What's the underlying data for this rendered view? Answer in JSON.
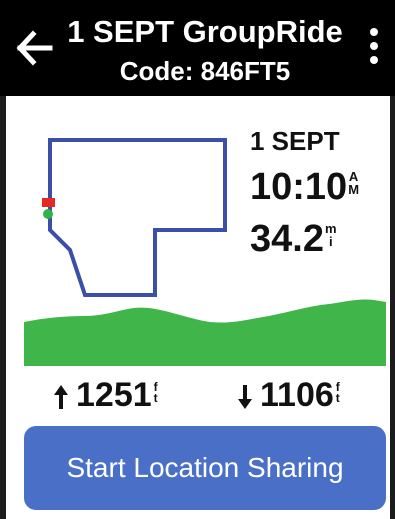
{
  "header": {
    "title": "1 SEPT GroupRide",
    "subtitle": "Code: 846FT5"
  },
  "ride": {
    "date": "1 SEPT",
    "time": "10:10",
    "time_unit_top": "A",
    "time_unit_bottom": "M",
    "distance": "34.2",
    "distance_unit_top": "m",
    "distance_unit_bottom": "i"
  },
  "elevation_stats": {
    "ascent": "1251",
    "descent": "1106",
    "unit_top": "f",
    "unit_bottom": "t"
  },
  "actions": {
    "share_label": "Start Location Sharing"
  },
  "colors": {
    "header_bg": "#000000",
    "route_line": "#3b4ea8",
    "start_marker": "#2db34a",
    "end_marker": "#e8281e",
    "elevation_fill": "#3fb54a",
    "button_bg": "#4a6fc7"
  },
  "icons": {
    "back": "back-arrow-icon",
    "menu": "more-vert-icon",
    "ascent": "arrow-up-icon",
    "descent": "arrow-down-icon"
  }
}
